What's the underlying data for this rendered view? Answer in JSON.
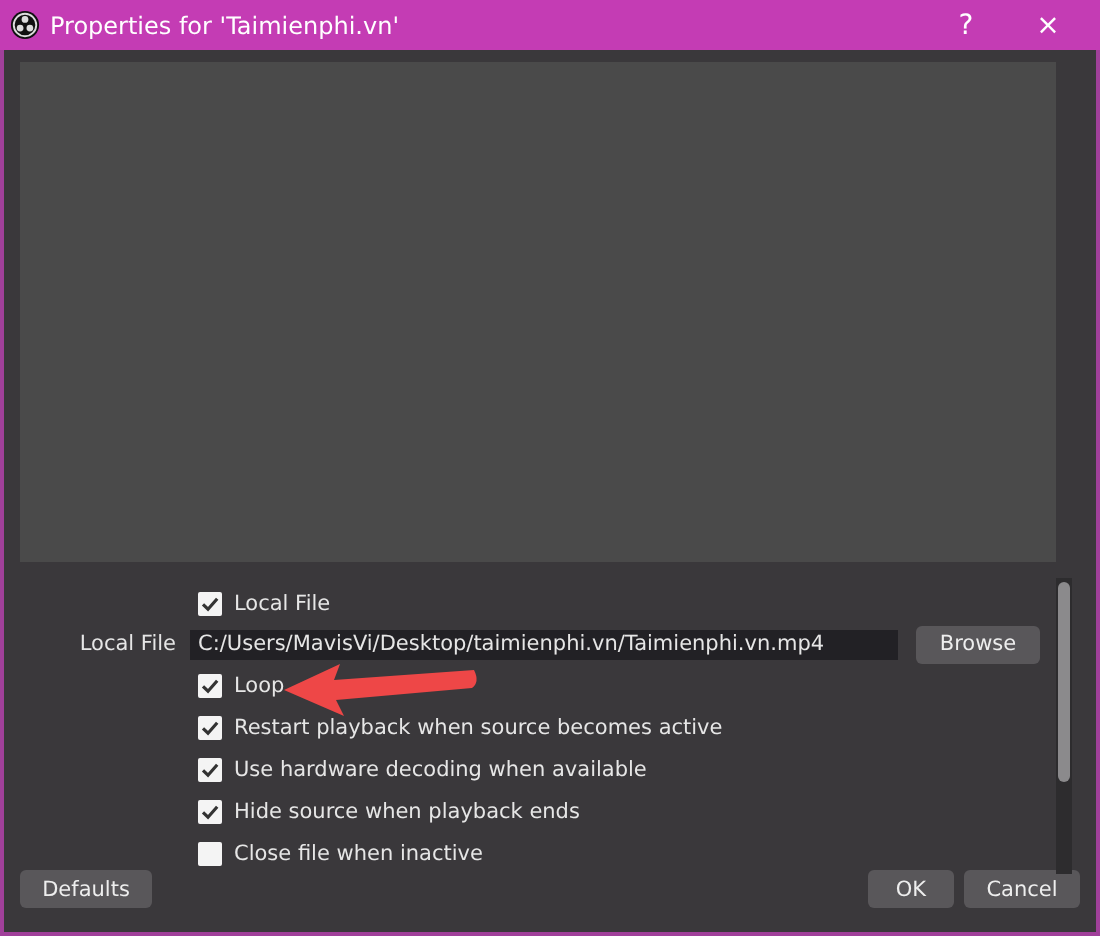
{
  "window": {
    "title": "Properties for 'Taimienphi.vn'",
    "help": "?",
    "close": "×"
  },
  "properties": [
    {
      "kind": "checkbox",
      "label": "Local File",
      "checked": true
    },
    {
      "kind": "file",
      "label": "Local File",
      "value": "C:/Users/MavisVi/Desktop/taimienphi.vn/Taimienphi.vn.mp4",
      "button": "Browse"
    },
    {
      "kind": "checkbox",
      "label": "Loop",
      "checked": true,
      "pointed": true
    },
    {
      "kind": "checkbox",
      "label": "Restart playback when source becomes active",
      "checked": true
    },
    {
      "kind": "checkbox",
      "label": "Use hardware decoding when available",
      "checked": true
    },
    {
      "kind": "checkbox",
      "label": "Hide source when playback ends",
      "checked": true
    },
    {
      "kind": "checkbox",
      "label": "Close file when inactive",
      "checked": false
    }
  ],
  "buttons": {
    "defaults": "Defaults",
    "ok": "OK",
    "cancel": "Cancel"
  }
}
